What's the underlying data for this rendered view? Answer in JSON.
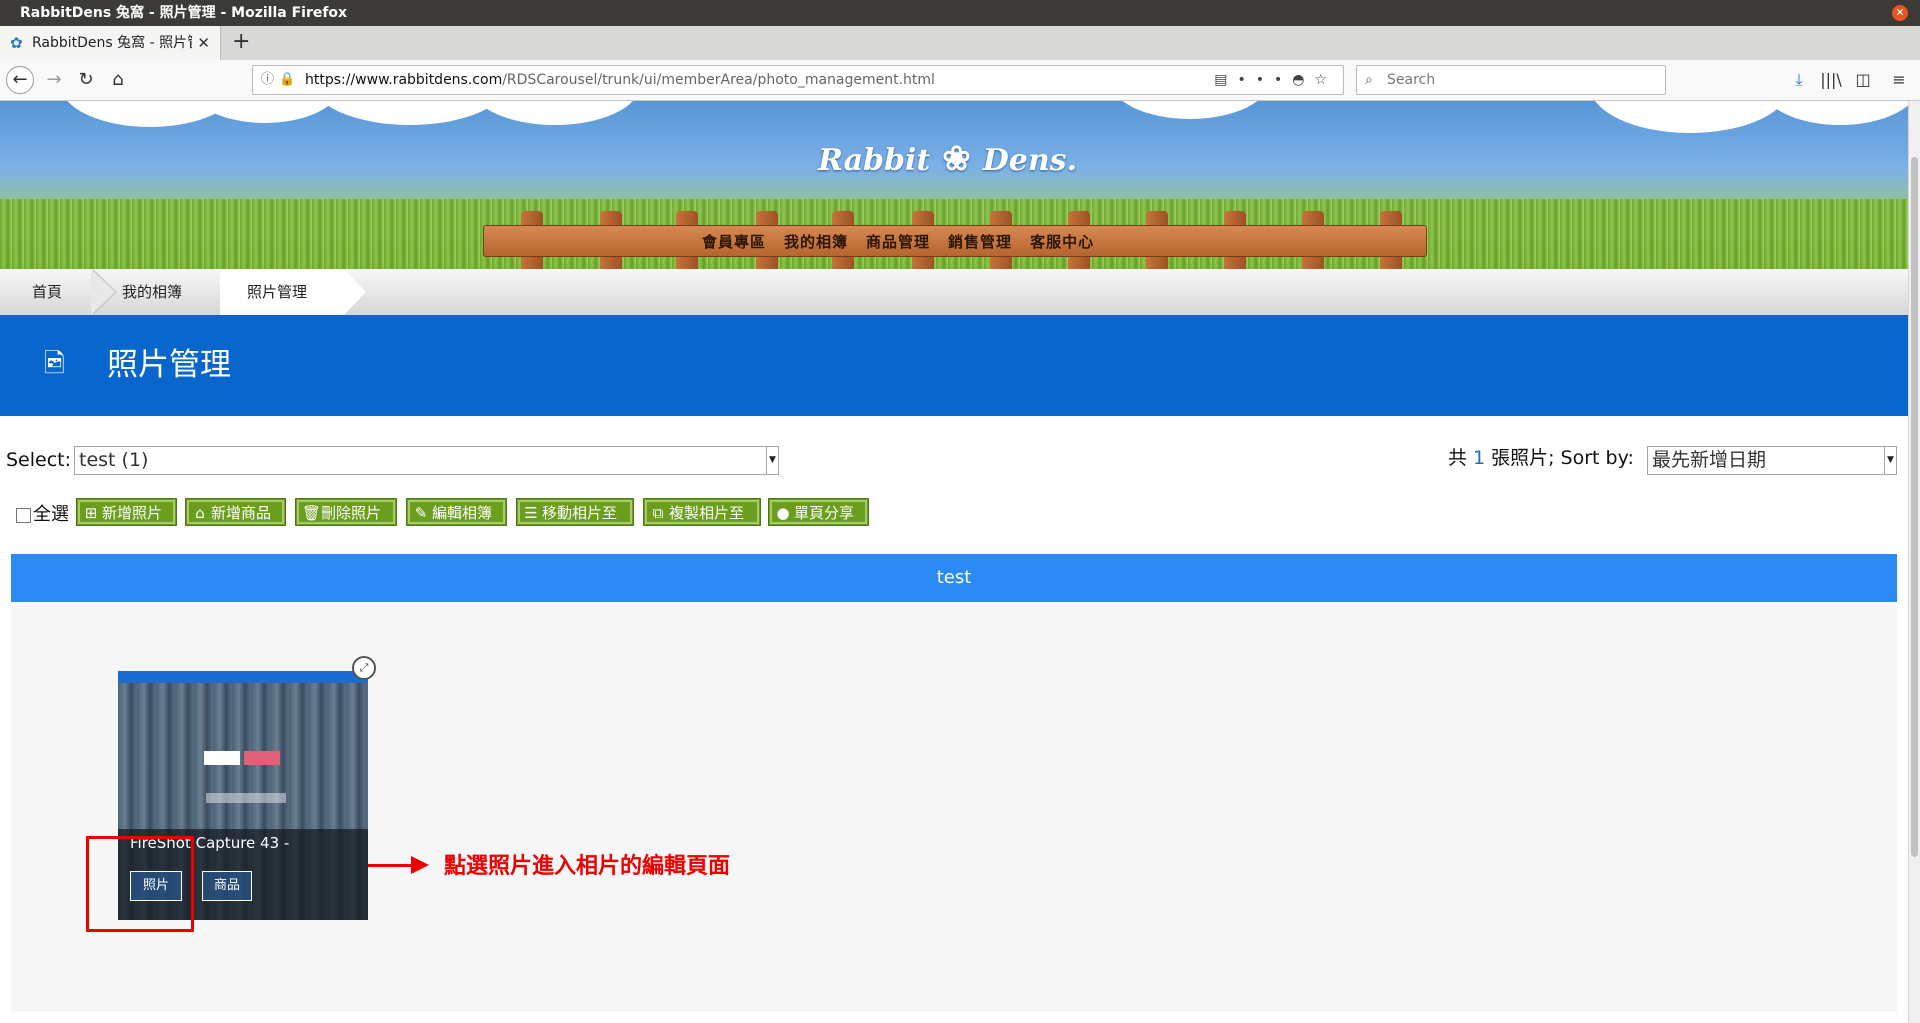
{
  "window": {
    "title": "RabbitDens 兔窩 - 照片管理 - Mozilla Firefox",
    "close_glyph": "✕"
  },
  "browser": {
    "tab": {
      "title": "RabbitDens 兔窩 - 照片管",
      "close_glyph": "✕",
      "favicon_glyph": "✿"
    },
    "new_tab_glyph": "+",
    "url_host": "https://www.rabbitdens.com",
    "url_path": "/RDSCarousel/trunk/ui/memberArea/photo_management.html",
    "search_placeholder": "Search",
    "icons": [
      "back-icon",
      "forward-icon",
      "reload-icon",
      "home-icon",
      "info-icon",
      "lock-icon",
      "reader-view-icon",
      "more-icon",
      "pocket-icon",
      "bookmark-star-icon",
      "download-icon",
      "library-icon",
      "sidebar-icon",
      "menu-icon"
    ]
  },
  "site": {
    "logo_left": "Rabbit",
    "logo_right": "Dens.",
    "logo_glyph": "❀",
    "menu": [
      "會員專區",
      "我的相簿",
      "商品管理",
      "銷售管理",
      "客服中心"
    ]
  },
  "breadcrumb": [
    "首頁",
    "我的相簿",
    "照片管理"
  ],
  "page": {
    "title": "照片管理",
    "title_icon_glyph": "🖻"
  },
  "toolbar": {
    "select_label": "Select:",
    "album_select_value": "test (1)",
    "count_prefix": "共",
    "count_value": "1",
    "count_suffix": "張照片; Sort by:",
    "sort_select_value": "最先新增日期",
    "select_all_label": "全選",
    "buttons": [
      {
        "label": "新增照片",
        "glyph": "⊞"
      },
      {
        "label": "新增商品",
        "glyph": "⌂"
      },
      {
        "label": "刪除照片",
        "glyph": "🗑"
      },
      {
        "label": "編輯相簿",
        "glyph": "✎"
      },
      {
        "label": "移動相片至",
        "glyph": "☰"
      },
      {
        "label": "複製相片至",
        "glyph": "⧉"
      },
      {
        "label": "單頁分享",
        "glyph": "●"
      }
    ]
  },
  "album": {
    "name": "test",
    "photos": [
      {
        "title": "FireShot Capture 43 -",
        "photo_button": "照片",
        "product_button": "商品"
      }
    ]
  },
  "annotation": {
    "text": "點選照片進入相片的編輯頁面",
    "color": "#ee0000"
  },
  "colors": {
    "page_header": "#0866cc",
    "album_bar": "#2b8af4",
    "action_button": "#6b9e1f",
    "count_number": "#1f6fbf"
  }
}
